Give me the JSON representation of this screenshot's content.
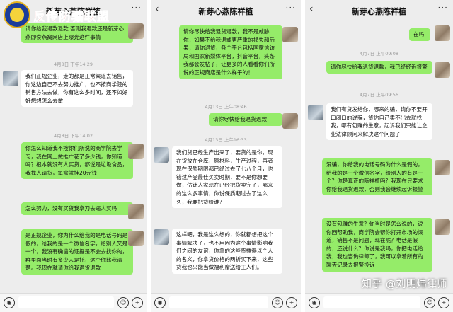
{
  "branding": {
    "logo_text": "反传防骗联盟",
    "watermark": "知乎 @刘明炜律师"
  },
  "phones": [
    {
      "title": "新芽心燕陈祥植",
      "messages": [
        {
          "side": "right",
          "text": "请你给我退款退款 否则我退款还是新芽心燕即食燕窝网店上曝光这件事情"
        },
        {
          "time": "4月8日 下午14:29"
        },
        {
          "side": "left",
          "text": "我们正规企业，走的都是正常渠道去销售，你这边自己不去努力推广，也不按商学院的销售方法去做，你有这么多时间，还不如好好想想怎么去做"
        },
        {
          "time": "4月8日 下午14:02"
        },
        {
          "side": "right",
          "text": "你怎么知道我不按你们所说的商学院去学习，我在网上做推广花了多少钱，你知道吗？根本就没有人买货，都说是垃圾食品，我找人请货，每盒就挂20元钱"
        },
        {
          "side": "right",
          "text": "怎么努力，没有买货我拿刀去逼人买吗"
        },
        {
          "side": "left",
          "text": "是正规企业，你为什么给我的是电话号码是假的，给我的是一个微信名字，给别人又是一个，我没有确凿的证据是不会去找你的，群里面当时有多少人是托，这个你比我清楚。我现在就请你给我退货退款"
        }
      ],
      "footer": {
        "voice_icon": "◉",
        "emoji_icon": "☺",
        "plus_icon": "+"
      }
    },
    {
      "title": "新芽心燕陈祥植",
      "messages": [
        {
          "side": "right",
          "text": "请你尽快给我退货退款，我不是威胁你，如果不给我退或更严重的损失和后果，请你退货，各个平台包括国家信访局和国家新媒体平台，抖音平台，头条我都会发帖子，让更多的人看看你们所说的正规商店是什么样子的！"
        },
        {
          "time": "4月13日 上午08:46"
        },
        {
          "side": "right",
          "text": "请你尽快给我退货退款"
        },
        {
          "time": "4月13日 上午16:33"
        },
        {
          "side": "left",
          "text": "我们货已经生产出来了，要货的是你，现在货放在仓库，原材料，生产过程，再者现在保质期限都已经过去了七八个月，也错过产品最佳买卖时期，要不是你想要做，估计人家现在已经把货卖完了，哪来的这么多事情，你说保质期过去了这么久，我要把货给谁？"
        },
        {
          "side": "left",
          "text": "这样吧，我是这么想的，你就都想把这个事情解决了，也不用因为这个事情影响我们之间的友谊，你拿的这些货摊得以个人的名义，你拿货价格的两折买下来，这些货我也只能当做福利赠送给工人们。"
        }
      ],
      "footer": {
        "voice_icon": "◉",
        "emoji_icon": "☺",
        "plus_icon": "+"
      }
    },
    {
      "title": "新芽心燕陈祥植",
      "messages": [
        {
          "side": "right",
          "text": "在吗"
        },
        {
          "time": "4月7日 上午09:08"
        },
        {
          "side": "right",
          "text": "请你尽快给我退货退款，我已经经诉报警"
        },
        {
          "time": "4月7日 上午09:56"
        },
        {
          "side": "left",
          "text": "我们有货发给你，哪来的骗，请你不要开口闭口的说骗，货你自己卖不出去就找我，哪有包赚的生意，起诉我们只能让企业法律顾问来解决这个问题了"
        },
        {
          "side": "right",
          "text": "没骗，你给我的电话号码为什么是假的，给我的是一个微信名字，给别人的有是一个？你是真正的陈祥植吗？我现在只要求你给我退货退款，否则我会继续起诉报警"
        },
        {
          "side": "right",
          "text": "没有包赚的生意？你当时是怎么说的，说你回帮助我，商学院会帮你打开市场的渠道，销售不是问题，现在呢？电话是假的，还说什么？你说是我吗，你把电话给我，我也咨询律师了，我可以拿着所有的聊天记录去报警投诉"
        }
      ],
      "footer": {
        "voice_icon": "◉",
        "emoji_icon": "☺",
        "plus_icon": "+"
      }
    }
  ]
}
